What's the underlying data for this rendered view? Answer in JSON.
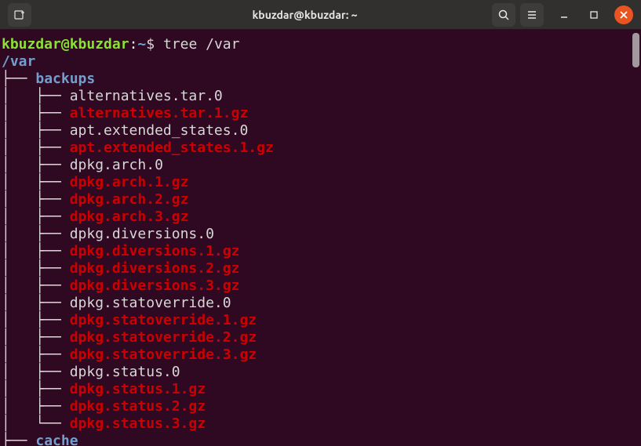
{
  "window": {
    "title": "kbuzdar@kbuzdar: ~"
  },
  "chart_data": {
    "type": "table",
    "title": "tree /var",
    "series": [
      {
        "name": "backups",
        "values": [
          "alternatives.tar.0",
          "alternatives.tar.1.gz",
          "apt.extended_states.0",
          "apt.extended_states.1.gz",
          "dpkg.arch.0",
          "dpkg.arch.1.gz",
          "dpkg.arch.2.gz",
          "dpkg.arch.3.gz",
          "dpkg.diversions.0",
          "dpkg.diversions.1.gz",
          "dpkg.diversions.2.gz",
          "dpkg.diversions.3.gz",
          "dpkg.statoverride.0",
          "dpkg.statoverride.1.gz",
          "dpkg.statoverride.2.gz",
          "dpkg.statoverride.3.gz",
          "dpkg.status.0",
          "dpkg.status.1.gz",
          "dpkg.status.2.gz",
          "dpkg.status.3.gz"
        ]
      },
      {
        "name": "cache",
        "values": []
      }
    ]
  },
  "prompt": {
    "userhost": "kbuzdar@kbuzdar",
    "sep": ":",
    "cwd": "~",
    "sigil": "$ ",
    "command": "tree /var"
  },
  "tree": {
    "root": "/var",
    "dirs": [
      {
        "name": "backups",
        "branch_last": false,
        "files": [
          {
            "name": "alternatives.tar.0",
            "gz": false,
            "last": false
          },
          {
            "name": "alternatives.tar.1.gz",
            "gz": true,
            "last": false
          },
          {
            "name": "apt.extended_states.0",
            "gz": false,
            "last": false
          },
          {
            "name": "apt.extended_states.1.gz",
            "gz": true,
            "last": false
          },
          {
            "name": "dpkg.arch.0",
            "gz": false,
            "last": false
          },
          {
            "name": "dpkg.arch.1.gz",
            "gz": true,
            "last": false
          },
          {
            "name": "dpkg.arch.2.gz",
            "gz": true,
            "last": false
          },
          {
            "name": "dpkg.arch.3.gz",
            "gz": true,
            "last": false
          },
          {
            "name": "dpkg.diversions.0",
            "gz": false,
            "last": false
          },
          {
            "name": "dpkg.diversions.1.gz",
            "gz": true,
            "last": false
          },
          {
            "name": "dpkg.diversions.2.gz",
            "gz": true,
            "last": false
          },
          {
            "name": "dpkg.diversions.3.gz",
            "gz": true,
            "last": false
          },
          {
            "name": "dpkg.statoverride.0",
            "gz": false,
            "last": false
          },
          {
            "name": "dpkg.statoverride.1.gz",
            "gz": true,
            "last": false
          },
          {
            "name": "dpkg.statoverride.2.gz",
            "gz": true,
            "last": false
          },
          {
            "name": "dpkg.statoverride.3.gz",
            "gz": true,
            "last": false
          },
          {
            "name": "dpkg.status.0",
            "gz": false,
            "last": false
          },
          {
            "name": "dpkg.status.1.gz",
            "gz": true,
            "last": false
          },
          {
            "name": "dpkg.status.2.gz",
            "gz": true,
            "last": false
          },
          {
            "name": "dpkg.status.3.gz",
            "gz": true,
            "last": true
          }
        ]
      },
      {
        "name": "cache",
        "branch_last": false,
        "files": []
      }
    ]
  }
}
